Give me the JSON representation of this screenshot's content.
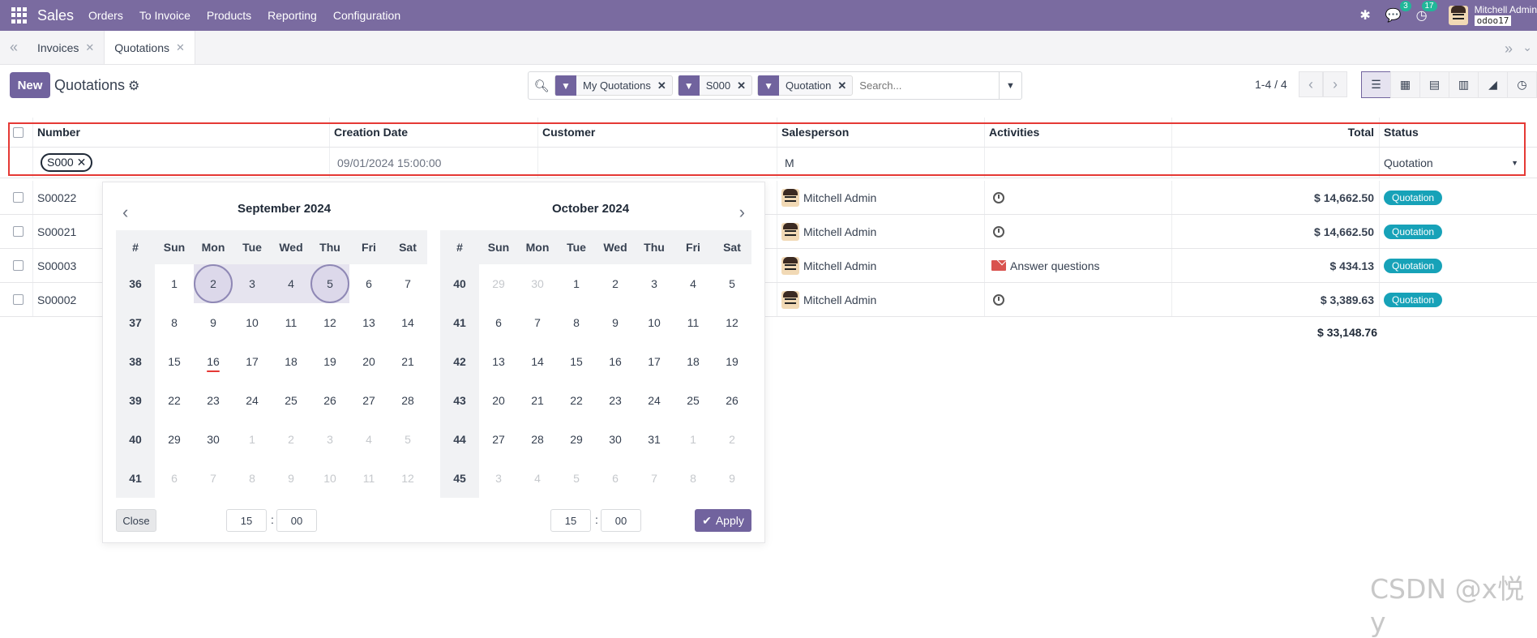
{
  "navbar": {
    "app_name": "Sales",
    "menu": [
      "Orders",
      "To Invoice",
      "Products",
      "Reporting",
      "Configuration"
    ],
    "chat_badge": "3",
    "activity_badge": "17",
    "user_name": "Mitchell Admin",
    "db_name": "odoo17"
  },
  "breadcrumbs": [
    {
      "label": "Invoices"
    },
    {
      "label": "Quotations"
    }
  ],
  "control": {
    "new_label": "New",
    "title": "Quotations",
    "facets": [
      "My Quotations",
      "S000",
      "Quotation"
    ],
    "search_placeholder": "Search...",
    "pager": "1-4 / 4"
  },
  "table": {
    "headers": {
      "number": "Number",
      "creation_date": "Creation Date",
      "customer": "Customer",
      "salesperson": "Salesperson",
      "activities": "Activities",
      "total": "Total",
      "status": "Status"
    },
    "filters": {
      "number_chip": "S000",
      "creation_date": "09/01/2024 15:00:00",
      "salesperson": "M",
      "status": "Quotation"
    },
    "rows": [
      {
        "number": "S00022",
        "salesperson": "Mitchell Admin",
        "activity": "",
        "total": "$ 14,662.50",
        "status": "Quotation"
      },
      {
        "number": "S00021",
        "salesperson": "Mitchell Admin",
        "activity": "",
        "total": "$ 14,662.50",
        "status": "Quotation"
      },
      {
        "number": "S00003",
        "salesperson": "Mitchell Admin",
        "activity": "Answer questions",
        "total": "$ 434.13",
        "status": "Quotation"
      },
      {
        "number": "S00002",
        "salesperson": "Mitchell Admin",
        "activity": "",
        "total": "$ 3,389.63",
        "status": "Quotation"
      }
    ],
    "grand_total": "$ 33,148.76"
  },
  "datepicker": {
    "left_month": "September 2024",
    "right_month": "October 2024",
    "weekday_header": [
      "#",
      "Sun",
      "Mon",
      "Tue",
      "Wed",
      "Thu",
      "Fri",
      "Sat"
    ],
    "left_weeks": [
      {
        "wk": "36",
        "days": [
          "1",
          "2",
          "3",
          "4",
          "5",
          "6",
          "7"
        ]
      },
      {
        "wk": "37",
        "days": [
          "8",
          "9",
          "10",
          "11",
          "12",
          "13",
          "14"
        ]
      },
      {
        "wk": "38",
        "days": [
          "15",
          "16",
          "17",
          "18",
          "19",
          "20",
          "21"
        ]
      },
      {
        "wk": "39",
        "days": [
          "22",
          "23",
          "24",
          "25",
          "26",
          "27",
          "28"
        ]
      },
      {
        "wk": "40",
        "days": [
          "29",
          "30",
          "1",
          "2",
          "3",
          "4",
          "5"
        ]
      },
      {
        "wk": "41",
        "days": [
          "6",
          "7",
          "8",
          "9",
          "10",
          "11",
          "12"
        ]
      }
    ],
    "right_weeks": [
      {
        "wk": "40",
        "days": [
          "29",
          "30",
          "1",
          "2",
          "3",
          "4",
          "5"
        ]
      },
      {
        "wk": "41",
        "days": [
          "6",
          "7",
          "8",
          "9",
          "10",
          "11",
          "12"
        ]
      },
      {
        "wk": "42",
        "days": [
          "13",
          "14",
          "15",
          "16",
          "17",
          "18",
          "19"
        ]
      },
      {
        "wk": "43",
        "days": [
          "20",
          "21",
          "22",
          "23",
          "24",
          "25",
          "26"
        ]
      },
      {
        "wk": "44",
        "days": [
          "27",
          "28",
          "29",
          "30",
          "31",
          "1",
          "2"
        ]
      },
      {
        "wk": "45",
        "days": [
          "3",
          "4",
          "5",
          "6",
          "7",
          "8",
          "9"
        ]
      }
    ],
    "close_label": "Close",
    "left_hour": "15",
    "left_minute": "00",
    "right_hour": "15",
    "right_minute": "00",
    "apply_label": "Apply"
  },
  "watermark": "CSDN @x悦y"
}
